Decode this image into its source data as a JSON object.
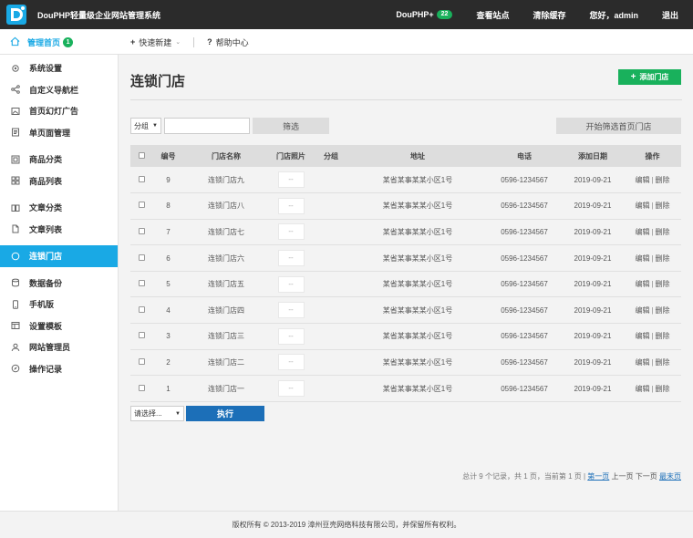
{
  "header": {
    "title": "DouPHP轻量级企业网站管理系统",
    "plus_label": "DouPHP+",
    "plus_badge": "22",
    "view_site": "查看站点",
    "clear_cache": "清除缓存",
    "greeting": "您好，admin",
    "logout": "退出"
  },
  "subbar": {
    "home_label": "管理首页",
    "home_badge": "1",
    "quick_new": "快速新建",
    "help": "帮助中心"
  },
  "sidebar": {
    "group1": [
      {
        "label": "系统设置",
        "icon": "gear-icon"
      },
      {
        "label": "自定义导航栏",
        "icon": "share-icon"
      },
      {
        "label": "首页幻灯广告",
        "icon": "image-icon"
      },
      {
        "label": "单页面管理",
        "icon": "page-icon"
      }
    ],
    "group2": [
      {
        "label": "商品分类",
        "icon": "grid-icon"
      },
      {
        "label": "商品列表",
        "icon": "tiles-icon"
      }
    ],
    "group3": [
      {
        "label": "文章分类",
        "icon": "book-icon"
      },
      {
        "label": "文章列表",
        "icon": "file-icon"
      }
    ],
    "group4": [
      {
        "label": "连锁门店",
        "icon": "circle-icon"
      }
    ],
    "group5": [
      {
        "label": "数据备份",
        "icon": "database-icon"
      },
      {
        "label": "手机版",
        "icon": "phone-icon"
      },
      {
        "label": "设置模板",
        "icon": "template-icon"
      },
      {
        "label": "网站管理员",
        "icon": "user-icon"
      },
      {
        "label": "操作记录",
        "icon": "compass-icon"
      }
    ]
  },
  "main": {
    "title": "连锁门店",
    "add_button": "添加门店",
    "filter": {
      "group_select": "分组",
      "keyword_value": "",
      "filter_button": "筛选",
      "home_filter_button": "开始筛选首页门店"
    },
    "table": {
      "headers": [
        "编号",
        "门店名称",
        "门店照片",
        "分组",
        "地址",
        "电话",
        "添加日期",
        "操作"
      ],
      "rows": [
        {
          "id": "9",
          "name": "连锁门店九",
          "photo": "--",
          "group": "",
          "address": "某省某事某某小区1号",
          "phone": "0596-1234567",
          "date": "2019-09-21"
        },
        {
          "id": "8",
          "name": "连锁门店八",
          "photo": "--",
          "group": "",
          "address": "某省某事某某小区1号",
          "phone": "0596-1234567",
          "date": "2019-09-21"
        },
        {
          "id": "7",
          "name": "连锁门店七",
          "photo": "--",
          "group": "",
          "address": "某省某事某某小区1号",
          "phone": "0596-1234567",
          "date": "2019-09-21"
        },
        {
          "id": "6",
          "name": "连锁门店六",
          "photo": "--",
          "group": "",
          "address": "某省某事某某小区1号",
          "phone": "0596-1234567",
          "date": "2019-09-21"
        },
        {
          "id": "5",
          "name": "连锁门店五",
          "photo": "--",
          "group": "",
          "address": "某省某事某某小区1号",
          "phone": "0596-1234567",
          "date": "2019-09-21"
        },
        {
          "id": "4",
          "name": "连锁门店四",
          "photo": "--",
          "group": "",
          "address": "某省某事某某小区1号",
          "phone": "0596-1234567",
          "date": "2019-09-21"
        },
        {
          "id": "3",
          "name": "连锁门店三",
          "photo": "--",
          "group": "",
          "address": "某省某事某某小区1号",
          "phone": "0596-1234567",
          "date": "2019-09-21"
        },
        {
          "id": "2",
          "name": "连锁门店二",
          "photo": "--",
          "group": "",
          "address": "某省某事某某小区1号",
          "phone": "0596-1234567",
          "date": "2019-09-21"
        },
        {
          "id": "1",
          "name": "连锁门店一",
          "photo": "--",
          "group": "",
          "address": "某省某事某某小区1号",
          "phone": "0596-1234567",
          "date": "2019-09-21"
        }
      ],
      "edit_label": "编辑",
      "delete_label": "删除"
    },
    "batch": {
      "select_label": "请选择...",
      "exec_button": "执行"
    },
    "pager": {
      "summary": "总计 9 个记录，共 1 页，当前第 1 页 |",
      "first": "第一页",
      "prev": "上一页",
      "next": "下一页",
      "last": "最末页"
    }
  },
  "footer": {
    "text": "版权所有 © 2013-2019 漳州豆壳网络科技有限公司，并保留所有权利。"
  },
  "colors": {
    "topbar": "#2b2b2b",
    "accent_blue": "#19a9e5",
    "green": "#19b15c",
    "link": "#1c6fb8"
  }
}
